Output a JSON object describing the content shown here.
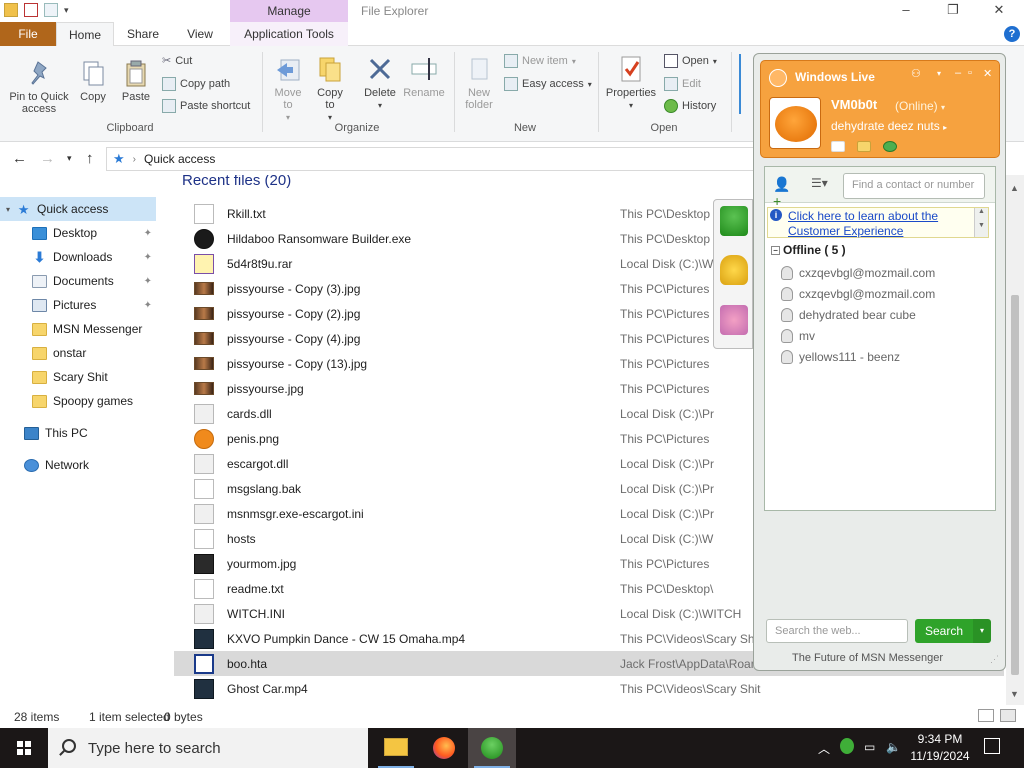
{
  "window": {
    "title": "File Explorer",
    "context_tab": "Manage",
    "controls": [
      "–",
      "❐",
      "✕"
    ]
  },
  "ribbon_tabs": [
    "File",
    "Home",
    "Share",
    "View",
    "Application Tools"
  ],
  "ribbon": {
    "clipboard": {
      "pin_label": "Pin to Quick access",
      "copy": "Copy",
      "paste": "Paste",
      "cut": "Cut",
      "copy_path": "Copy path",
      "paste_shortcut": "Paste shortcut",
      "group": "Clipboard"
    },
    "organize": {
      "move_to": "Move to",
      "copy_to": "Copy to",
      "delete": "Delete",
      "rename": "Rename",
      "group": "Organize"
    },
    "new": {
      "new_folder": "New folder",
      "new_item": "New item",
      "easy_access": "Easy access",
      "group": "New"
    },
    "open": {
      "properties": "Properties",
      "open": "Open",
      "edit": "Edit",
      "history": "History",
      "group": "Open"
    }
  },
  "address": {
    "path": "Quick access"
  },
  "nav": [
    {
      "label": "Quick access",
      "icon": "star-icon"
    },
    {
      "label": "Desktop",
      "icon": "desktop-icon"
    },
    {
      "label": "Downloads",
      "icon": "download-icon"
    },
    {
      "label": "Documents",
      "icon": "documents-icon"
    },
    {
      "label": "Pictures",
      "icon": "pictures-icon"
    },
    {
      "label": "MSN Messenger",
      "icon": "folder-icon"
    },
    {
      "label": "onstar",
      "icon": "folder-icon"
    },
    {
      "label": "Scary Shit",
      "icon": "folder-icon"
    },
    {
      "label": "Spoopy games",
      "icon": "folder-icon"
    },
    {
      "label": "This PC",
      "icon": "pc-icon"
    },
    {
      "label": "Network",
      "icon": "network-icon"
    }
  ],
  "files_header": "Recent files (20)",
  "files": [
    {
      "name": "Rkill.txt",
      "location": "This PC\\Desktop"
    },
    {
      "name": "Hildaboo Ransomware Builder.exe",
      "location": "This PC\\Desktop"
    },
    {
      "name": "5d4r8t9u.rar",
      "location": "Local Disk (C:)\\W"
    },
    {
      "name": "pissyourse - Copy (3).jpg",
      "location": "This PC\\Pictures"
    },
    {
      "name": "pissyourse - Copy (2).jpg",
      "location": "This PC\\Pictures"
    },
    {
      "name": "pissyourse - Copy (4).jpg",
      "location": "This PC\\Pictures"
    },
    {
      "name": "pissyourse - Copy (13).jpg",
      "location": "This PC\\Pictures"
    },
    {
      "name": "pissyourse.jpg",
      "location": "This PC\\Pictures"
    },
    {
      "name": "cards.dll",
      "location": "Local Disk (C:)\\Pr"
    },
    {
      "name": "penis.png",
      "location": "This PC\\Pictures"
    },
    {
      "name": "escargot.dll",
      "location": "Local Disk (C:)\\Pr"
    },
    {
      "name": "msgslang.bak",
      "location": "Local Disk (C:)\\Pr"
    },
    {
      "name": "msnmsgr.exe-escargot.ini",
      "location": "Local Disk (C:)\\Pr"
    },
    {
      "name": "hosts",
      "location": "Local Disk (C:)\\W"
    },
    {
      "name": "yourmom.jpg",
      "location": "This PC\\Pictures"
    },
    {
      "name": "readme.txt",
      "location": "This PC\\Desktop\\"
    },
    {
      "name": "WITCH.INI",
      "location": "Local Disk (C:)\\WITCH"
    },
    {
      "name": "KXVO Pumpkin Dance - CW 15 Omaha.mp4",
      "location": "This PC\\Videos\\Scary Shi"
    },
    {
      "name": "boo.hta",
      "location": "Jack Frost\\AppData\\Roam"
    },
    {
      "name": "Ghost Car.mp4",
      "location": "This PC\\Videos\\Scary Shit"
    }
  ],
  "status": {
    "items": "28 items",
    "selected": "1 item selected",
    "size": "0 bytes"
  },
  "msn": {
    "logo": "Windows Live",
    "name": "VM0b0t",
    "status": "(Online)",
    "personal_message": "dehydrate deez nuts",
    "find_placeholder": "Find a contact or number",
    "link_text": "Click here to learn about the Customer Experience",
    "group_label": "Offline ( 5 )",
    "contacts": [
      "cxzqevbgl@mozmail.com",
      "cxzqevbgl@mozmail.com",
      "dehydrated bear cube",
      "mv",
      "yellows111 - beenz"
    ],
    "search_placeholder": "Search the web...",
    "search_button": "Search",
    "footer": "The Future of MSN Messenger"
  },
  "taskbar": {
    "search_placeholder": "Type here to search",
    "time": "9:34 PM",
    "date": "11/19/2024"
  },
  "colors": {
    "file_tab": "#b0661b",
    "manage_tab": "#e6c8f0",
    "msn_orange": "#f6a23f",
    "msn_green": "#2fa32a",
    "selection": "#cce4f7"
  }
}
